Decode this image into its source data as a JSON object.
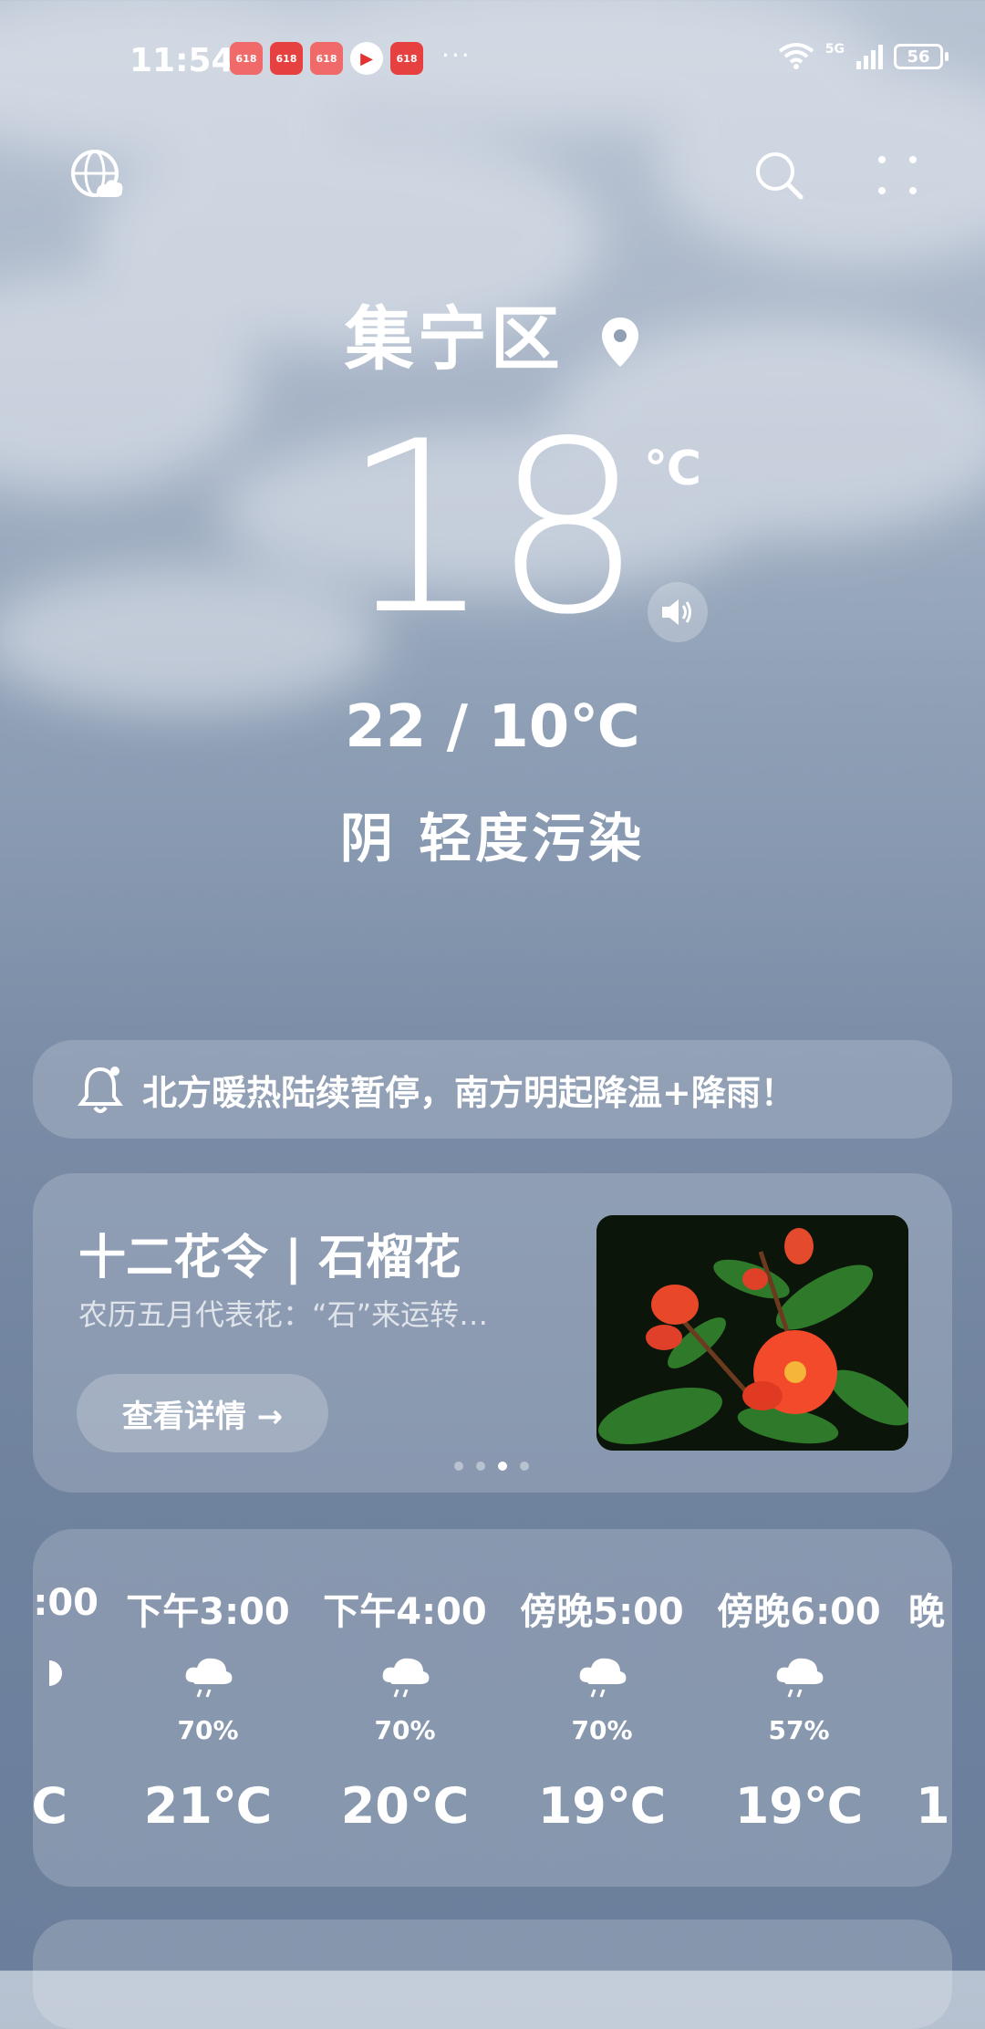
{
  "status": {
    "time": "11:54",
    "notifications": [
      "618",
      "618",
      "618",
      "▶",
      "618"
    ],
    "more": "···",
    "network": "5G",
    "battery": "56"
  },
  "header": {
    "left_icon": "globe-cloud-icon",
    "search_icon": "search-icon",
    "menu_icon": "dots-grid-icon"
  },
  "location": {
    "city": "集宁区",
    "icon": "location-pin-icon"
  },
  "current": {
    "temp": "18",
    "unit": "℃",
    "range": "22 / 10℃",
    "condition": "阴  轻度污染"
  },
  "alert": {
    "icon": "bell-icon",
    "text": "北方暖热陆续暂停，南方明起降温+降雨！"
  },
  "promo": {
    "title": "十二花令 | 石榴花",
    "subtitle": "农历五月代表花：“石”来运转…",
    "button": "查看详情 →",
    "image_desc_icon": "pomegranate-flower-image",
    "pages": 4,
    "active_page": 3
  },
  "hourly": [
    {
      "label": ":00",
      "pct": "",
      "temp": "C"
    },
    {
      "label": "下午3:00",
      "pct": "70%",
      "temp": "21℃"
    },
    {
      "label": "下午4:00",
      "pct": "70%",
      "temp": "20℃"
    },
    {
      "label": "傍晚5:00",
      "pct": "70%",
      "temp": "19℃"
    },
    {
      "label": "傍晚6:00",
      "pct": "57%",
      "temp": "19℃"
    },
    {
      "label": "晚",
      "pct": "",
      "temp": "1"
    }
  ],
  "colors": {
    "accent_red": "#e64040"
  }
}
